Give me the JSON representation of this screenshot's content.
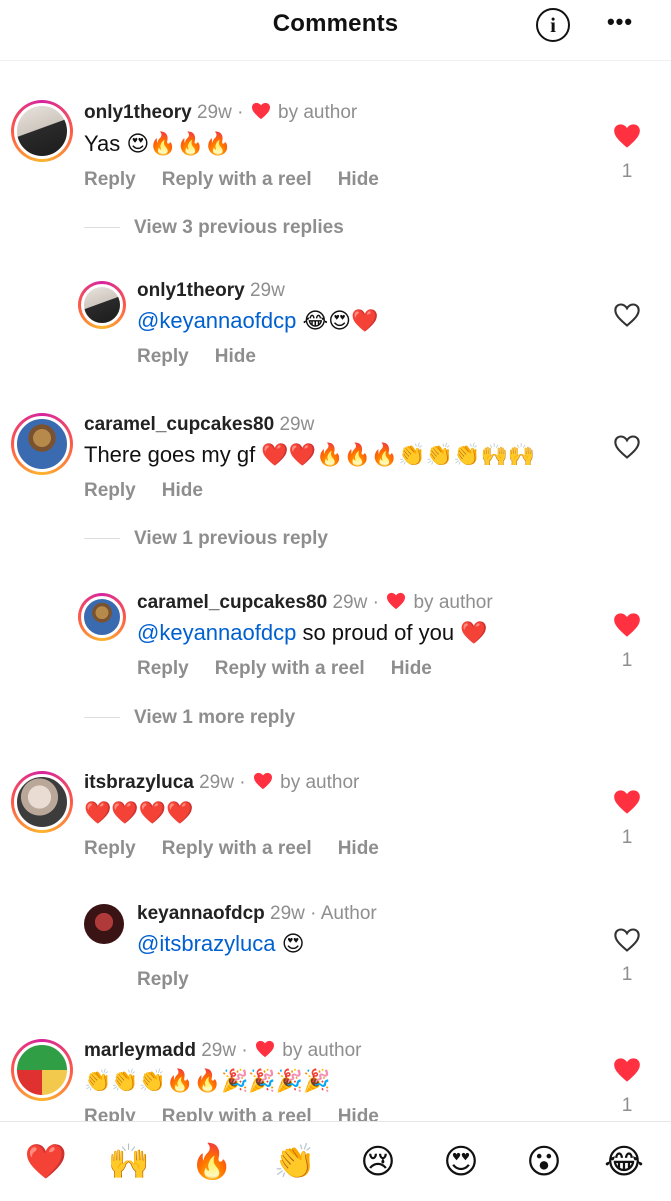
{
  "header": {
    "title": "Comments",
    "info_glyph": "i",
    "more_glyph": "•••"
  },
  "comments": [
    {
      "username": "only1theory",
      "time": "29w",
      "sep": " ·",
      "by_author": "by author",
      "text": "Yas 😍🔥🔥🔥",
      "actions": [
        "Reply",
        "Reply with a reel",
        "Hide"
      ],
      "liked": true,
      "likes": "1"
    },
    {
      "username": "only1theory",
      "time": "29w",
      "mention": "@keyannaofdcp",
      "text": " 😂😍❤️",
      "actions": [
        "Reply",
        "Hide"
      ],
      "liked": false
    },
    {
      "username": "caramel_cupcakes80",
      "time": "29w",
      "text": "There goes my gf ❤️❤️🔥🔥🔥👏👏👏🙌🙌",
      "actions": [
        "Reply",
        "Hide"
      ],
      "liked": false
    },
    {
      "username": "caramel_cupcakes80",
      "time": "29w",
      "sep": " ·",
      "by_author": "by author",
      "mention": "@keyannaofdcp",
      "text": " so proud of you ❤️",
      "actions": [
        "Reply",
        "Reply with a reel",
        "Hide"
      ],
      "liked": true,
      "likes": "1"
    },
    {
      "username": "itsbrazyluca",
      "time": "29w",
      "sep": " ·",
      "by_author": "by author",
      "text": "❤️❤️❤️❤️",
      "actions": [
        "Reply",
        "Reply with a reel",
        "Hide"
      ],
      "liked": true,
      "likes": "1"
    },
    {
      "username": "keyannaofdcp",
      "time": "29w",
      "sep": " ·",
      "author_badge": "Author",
      "mention": "@itsbrazyluca",
      "text": " 😍",
      "actions": [
        "Reply"
      ],
      "liked": false,
      "likes": "1"
    },
    {
      "username": "marleymadd",
      "time": "29w",
      "sep": " ·",
      "by_author": "by author",
      "text": "👏👏👏🔥🔥🎉🎉🎉🎉",
      "actions": [
        "Reply",
        "Reply with a reel",
        "Hide"
      ],
      "liked": true,
      "likes": "1"
    }
  ],
  "view_replies": [
    "View 3 previous replies",
    "View 1 previous reply",
    "View 1 more reply"
  ],
  "emoji_bar": [
    "❤️",
    "🙌",
    "🔥",
    "👏",
    "😢",
    "😍",
    "😮",
    "😂"
  ],
  "colors": {
    "like_red": "#ff3040",
    "mention_blue": "#0060d0",
    "meta_gray": "#8e8e8e"
  }
}
